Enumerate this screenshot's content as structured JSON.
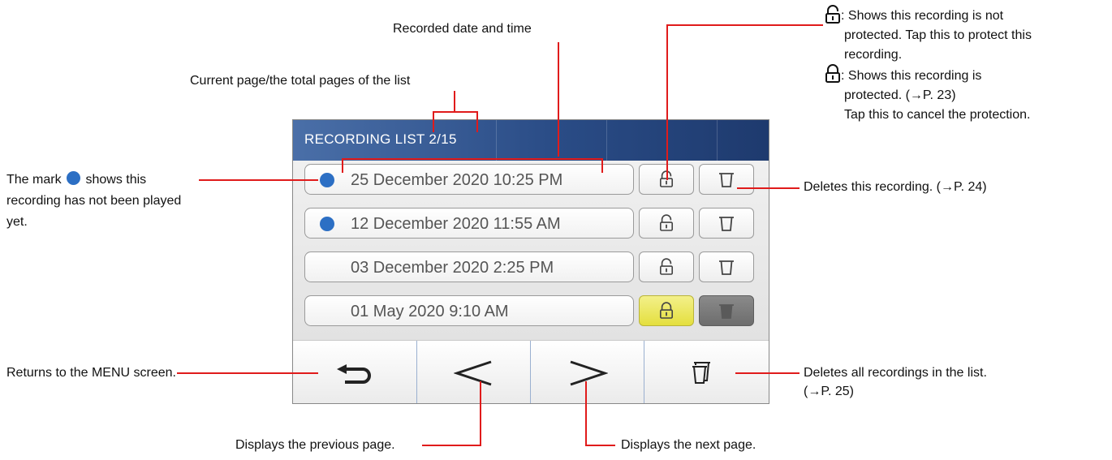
{
  "screen": {
    "title": "RECORDING LIST 2/15",
    "rows": [
      {
        "unplayed": true,
        "date": "25 December 2020 10:25 PM",
        "protected": false
      },
      {
        "unplayed": true,
        "date": "12 December 2020 11:55 AM",
        "protected": false
      },
      {
        "unplayed": false,
        "date": "03 December 2020 2:25 PM",
        "protected": false
      },
      {
        "unplayed": false,
        "date": "01 May 2020 9:10 AM",
        "protected": true
      }
    ],
    "icons": {
      "unplayed_mark": "blue-dot-icon",
      "unlocked": "unlocked-padlock-icon",
      "locked": "locked-padlock-icon",
      "delete": "trash-icon",
      "back": "return-arrow-icon",
      "prev": "chevron-left-icon",
      "next": "chevron-right-icon",
      "delete_all": "multi-trash-icon"
    },
    "colors": {
      "title_bar": "#2a4c86",
      "unplayed_dot": "#2c6fc4",
      "protected_button": "#e4df3e",
      "callout_line": "#e01b1b"
    }
  },
  "callouts": {
    "recorded_date": "Recorded date and time",
    "current_page": "Current page/the total pages of the list",
    "mark_line1_a": "The mark",
    "mark_line1_b": "shows this",
    "mark_line2": "recording has not been played",
    "mark_line3": "yet.",
    "unlock_line1": ": Shows this recording is not",
    "unlock_line2": "protected. Tap this to protect this",
    "unlock_line3": "recording.",
    "lock_line1": ": Shows this recording is",
    "lock_line2": "protected. (→P. 23)",
    "lock_line3": "Tap this to cancel the protection.",
    "delete_one": "Deletes this recording. (→P. 24)",
    "returns": "Returns to the MENU screen.",
    "delete_all_line1": "Deletes all recordings in the list.",
    "delete_all_line2": "(→P. 25)",
    "prev_page": "Displays the previous page.",
    "next_page": "Displays the next page."
  }
}
